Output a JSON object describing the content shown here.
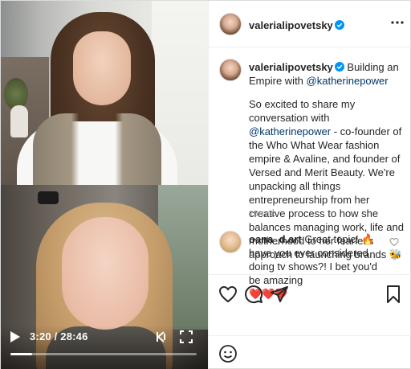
{
  "video": {
    "current_time": "3:20",
    "duration": "28:46",
    "time_separator": " / ",
    "progress_fraction": 0.116,
    "play_icon": "play-icon",
    "rewind_icon": "rewind-icon",
    "fullscreen_icon": "fullscreen-icon"
  },
  "header": {
    "username": "valerialipovetsky",
    "verified_icon": "verified-badge-icon",
    "more_icon": "more-options-icon"
  },
  "caption": {
    "username": "valerialipovetsky",
    "line1_text": " Building an Empire with ",
    "line1_mention": "@katherinepower",
    "body_before_mention": "So excited to share my conversation with ",
    "body_mention": "@katherinepower",
    "body_after_mention": " - co-founder of the Who What Wear fashion empire & Avaline, and founder of Versed and Merit Beauty. We're unpacking all things entrepreneurship from her creative process to how she balances managing work, life and motherhood to her fearless approach to launching brands 🐝",
    "time_ago": "15 тиж."
  },
  "comment": {
    "username": "oana_d.art",
    "text": " Great topic! 🔥 have you ever considered doing tv shows?! I bet you'd be amazing ",
    "emojis": "❤️❤️❤️",
    "like_icon": "heart-outline-icon"
  },
  "actions": {
    "like_icon": "heart-icon",
    "comment_icon": "comment-icon",
    "share_icon": "share-icon",
    "save_icon": "bookmark-icon",
    "emoji_icon": "emoji-icon"
  },
  "colors": {
    "text": "#262626",
    "link": "#00376b",
    "muted": "#8e8e8e",
    "verified": "#0095f6",
    "border": "#dbdbdb"
  }
}
